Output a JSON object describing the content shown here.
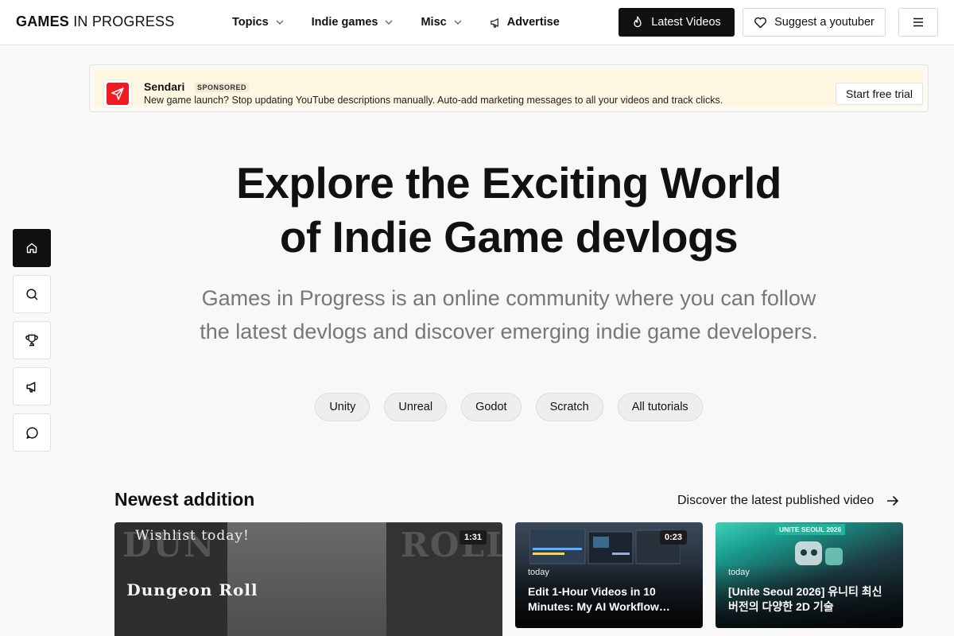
{
  "header": {
    "brand_bold": "GAMES",
    "brand_rest": " IN PROGRESS",
    "nav": {
      "topics": "Topics",
      "indie_games": "Indie games",
      "misc": "Misc",
      "advertise": "Advertise"
    },
    "latest_videos": "Latest Videos",
    "suggest": "Suggest a youtuber"
  },
  "sponsor": {
    "name": "Sendari",
    "tag": "SPONSORED",
    "description": "New game launch? Stop updating YouTube descriptions manually. Auto-add marketing messages to all your videos and track clicks.",
    "cta": "Start free trial",
    "brand_color": "#ee1c25"
  },
  "sidebar": {
    "items": [
      {
        "icon": "home-icon",
        "active": true
      },
      {
        "icon": "search-icon",
        "active": false
      },
      {
        "icon": "trophy-icon",
        "active": false
      },
      {
        "icon": "megaphone-icon",
        "active": false
      },
      {
        "icon": "chat-icon",
        "active": false
      }
    ]
  },
  "hero": {
    "title_line1": "Explore the Exciting World",
    "title_line2": "of Indie Game devlogs",
    "subtitle_line1": "Games in Progress is an online community where you can follow",
    "subtitle_line2": "the latest devlogs and discover emerging indie game developers."
  },
  "chips": [
    "Unity",
    "Unreal",
    "Godot",
    "Scratch",
    "All tutorials"
  ],
  "newest": {
    "title": "Newest addition",
    "link": "Discover the latest published video",
    "videos": [
      {
        "duration": "1:31",
        "overlay_top": "Wishlist today!",
        "overlay_main": "Dungeon Roll",
        "bg_left": "DUN",
        "bg_right": "ROLL"
      },
      {
        "duration": "0:23",
        "date": "today",
        "title": "Edit 1-Hour Videos in 10 Minutes: My AI Workflow…"
      },
      {
        "tag": "UNITE SEOUL 2026",
        "date": "today",
        "title": "[Unite Seoul 2026] 유니티 최신 버전의 다양한 2D 기술"
      }
    ]
  }
}
